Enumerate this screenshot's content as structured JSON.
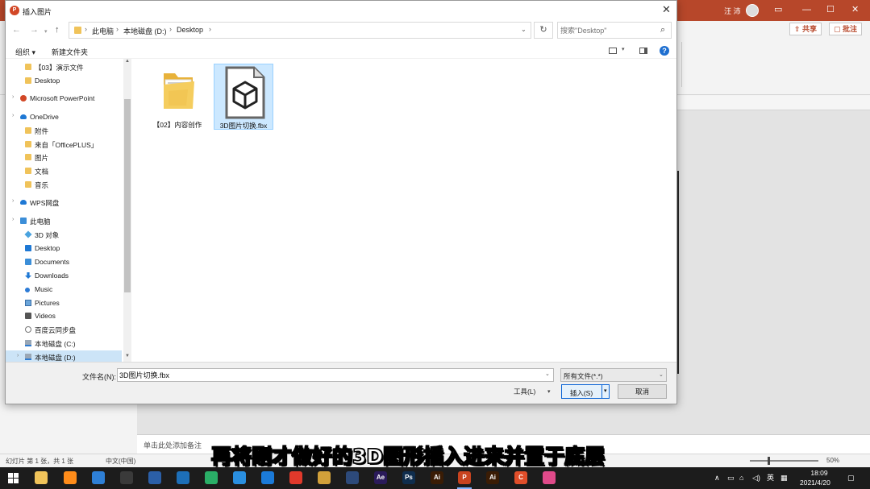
{
  "powerpoint": {
    "user_name": "汪 沛",
    "share_label": "共享",
    "comment_label": "批注",
    "notes_placeholder": "单击此处添加备注",
    "status": {
      "slide_count": "幻灯片 第 1 张，共 1 张",
      "language": "中文(中国)",
      "zoom": "50%"
    },
    "colors": {
      "accent": "#b7472a"
    }
  },
  "dialog": {
    "title": "插入图片",
    "breadcrumbs": [
      "此电脑",
      "本地磁盘 (D:)",
      "Desktop"
    ],
    "search_placeholder": "搜索\"Desktop\"",
    "toolbar": {
      "organize": "组织",
      "new_folder": "新建文件夹"
    },
    "nav_items": [
      {
        "label": "【03】演示文件",
        "icon": "folder-icon",
        "level": 1
      },
      {
        "label": "Desktop",
        "icon": "folder-icon",
        "level": 1
      },
      {
        "label": "Microsoft PowerPoint",
        "icon": "powerpoint-icon",
        "level": 0
      },
      {
        "label": "OneDrive",
        "icon": "cloud-icon",
        "level": 0
      },
      {
        "label": "附件",
        "icon": "folder-icon",
        "level": 1
      },
      {
        "label": "来自「OfficePLUS」",
        "icon": "folder-icon",
        "level": 1
      },
      {
        "label": "图片",
        "icon": "folder-icon",
        "level": 1
      },
      {
        "label": "文档",
        "icon": "folder-icon",
        "level": 1
      },
      {
        "label": "音乐",
        "icon": "folder-icon",
        "level": 1
      },
      {
        "label": "WPS网盘",
        "icon": "cloud-icon",
        "level": 0
      },
      {
        "label": "此电脑",
        "icon": "computer-icon",
        "level": 0
      },
      {
        "label": "3D 对象",
        "icon": "cube-icon",
        "level": 1
      },
      {
        "label": "Desktop",
        "icon": "desktop-icon",
        "level": 1
      },
      {
        "label": "Documents",
        "icon": "documents-icon",
        "level": 1
      },
      {
        "label": "Downloads",
        "icon": "download-icon",
        "level": 1
      },
      {
        "label": "Music",
        "icon": "music-icon",
        "level": 1
      },
      {
        "label": "Pictures",
        "icon": "pictures-icon",
        "level": 1
      },
      {
        "label": "Videos",
        "icon": "videos-icon",
        "level": 1
      },
      {
        "label": "百度云同步盘",
        "icon": "baidu-cloud-icon",
        "level": 1
      },
      {
        "label": "本地磁盘 (C:)",
        "icon": "drive-icon",
        "level": 1
      },
      {
        "label": "本地磁盘 (D:)",
        "icon": "drive-icon",
        "level": 1,
        "selected": true
      }
    ],
    "files": [
      {
        "name": "【02】内容创作",
        "type": "folder"
      },
      {
        "name": "3D图片切换.fbx",
        "type": "fbx",
        "selected": true
      }
    ],
    "filename_label": "文件名(N):",
    "filename_value": "3D图片切换.fbx",
    "filetype_value": "所有文件(*.*)",
    "tools_label": "工具(L)",
    "insert_label": "插入(S)",
    "cancel_label": "取消"
  },
  "subtitle": "再将刚才做好的3D图形插入进来并置于底层",
  "taskbar": {
    "apps": [
      {
        "name": "file-explorer",
        "label": "",
        "color": "#f0c35a"
      },
      {
        "name": "search-app",
        "label": "",
        "color": "#ff8c1a"
      },
      {
        "name": "cloud-app",
        "label": "",
        "color": "#2e7fd6"
      },
      {
        "name": "network-app",
        "label": "",
        "color": "#3a3a3a"
      },
      {
        "name": "store-app",
        "label": "",
        "color": "#2b5fa8"
      },
      {
        "name": "blue-app",
        "label": "",
        "color": "#1d6fb8"
      },
      {
        "name": "wechat-app",
        "label": "",
        "color": "#2aae67"
      },
      {
        "name": "feather-app",
        "label": "",
        "color": "#2a8fe0"
      },
      {
        "name": "edge-app",
        "label": "",
        "color": "#1b7ad8"
      },
      {
        "name": "chrome-app",
        "label": "",
        "color": "#e0392b"
      },
      {
        "name": "circle-app",
        "label": "",
        "color": "#d1a03a"
      },
      {
        "name": "dark-app",
        "label": "",
        "color": "#2d4a7a"
      },
      {
        "name": "after-effects-app",
        "label": "Ae",
        "color": "#2a1a5a"
      },
      {
        "name": "photoshop-app",
        "label": "Ps",
        "color": "#0f2d4d"
      },
      {
        "name": "illustrator-app",
        "label": "Ai",
        "color": "#3a1c05"
      },
      {
        "name": "powerpoint-app",
        "label": "P",
        "color": "#c8431f"
      },
      {
        "name": "illustrator-app-2",
        "label": "Ai",
        "color": "#3a1c05"
      },
      {
        "name": "c-app",
        "label": "C",
        "color": "#e04e2a"
      },
      {
        "name": "drop-app",
        "label": "",
        "color": "#e04a8a"
      }
    ],
    "ime": "英",
    "time": "18:09",
    "date": "2021/4/20"
  }
}
